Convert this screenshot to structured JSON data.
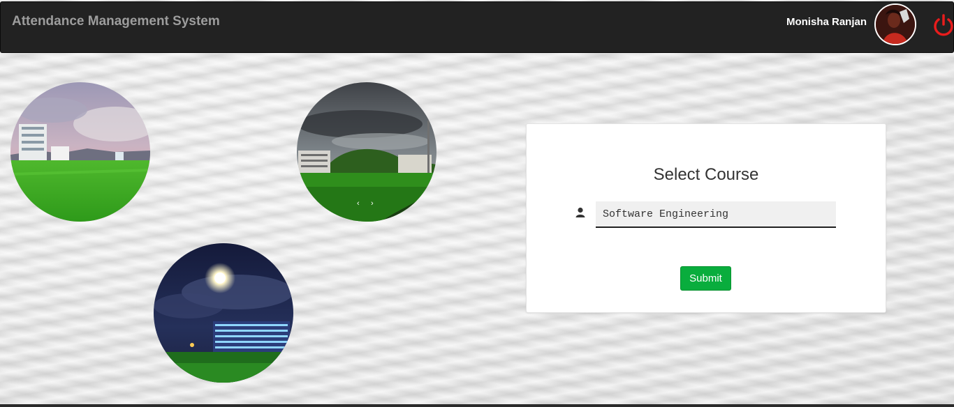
{
  "app": {
    "title": "Attendance Management System"
  },
  "user": {
    "name": "Monisha Ranjan",
    "avatar_icon": "user-avatar",
    "logout_icon": "power-icon"
  },
  "colors": {
    "navbar": "#222222",
    "brand_text": "#9d9d9d",
    "power": "#e81c1c",
    "submit": "#09ad3d"
  },
  "gallery": {
    "images": [
      "campus-daytime-photo",
      "campus-hills-photo",
      "campus-night-photo"
    ],
    "prev_label": "‹",
    "next_label": "›"
  },
  "form": {
    "title": "Select Course",
    "field_icon": "user-icon",
    "course_value": "Software Engineering",
    "submit_label": "Submit"
  }
}
